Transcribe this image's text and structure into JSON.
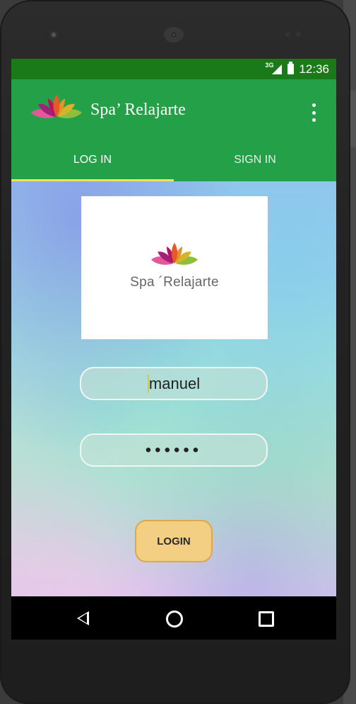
{
  "status_bar": {
    "signal": "3G",
    "time": "12:36"
  },
  "app_bar": {
    "title": "Spa’ Relajarte",
    "overflow_icon": "more-vert-icon"
  },
  "tabs": [
    {
      "label": "LOG IN",
      "active": true
    },
    {
      "label": "SIGN IN",
      "active": false
    }
  ],
  "logo": {
    "text": "Spa ´Relajarte"
  },
  "form": {
    "username_value": "manuel",
    "password_value": "••••••",
    "login_label": "LOGIN"
  },
  "nav_bar": {
    "back": "back-icon",
    "home": "home-icon",
    "recents": "recents-icon"
  },
  "colors": {
    "status_bar": "#1a7a1a",
    "app_bar": "#23a048",
    "tab_indicator": "#f0e35a",
    "login_button": "#f2cf82"
  }
}
